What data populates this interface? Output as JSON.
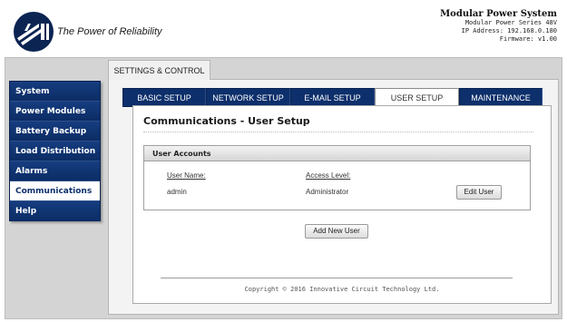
{
  "header": {
    "tagline": "The Power of Reliability",
    "system_title": "Modular Power System",
    "model": "Modular Power Series 48V",
    "ip_address": "IP Address: 192.168.0.180",
    "firmware": "Firmware: v1.00"
  },
  "sidebar": {
    "items": [
      {
        "label": "System"
      },
      {
        "label": "Power Modules"
      },
      {
        "label": "Battery Backup"
      },
      {
        "label": "Load Distribution"
      },
      {
        "label": "Alarms"
      },
      {
        "label": "Communications"
      },
      {
        "label": "Help"
      }
    ],
    "active": "Communications"
  },
  "settings_tab": {
    "label": "SETTINGS & CONTROL"
  },
  "tabs": [
    {
      "label": "BASIC SETUP"
    },
    {
      "label": "NETWORK SETUP"
    },
    {
      "label": "E-MAIL SETUP"
    },
    {
      "label": "USER SETUP"
    },
    {
      "label": "MAINTENANCE"
    }
  ],
  "active_tab": "USER SETUP",
  "content": {
    "title": "Communications - User Setup",
    "accounts": {
      "heading": "User Accounts",
      "col_user": "User Name:",
      "col_access": "Access Level:",
      "row": {
        "user": "admin",
        "access": "Administrator",
        "edit_label": "Edit User"
      }
    },
    "add_user_label": "Add New User",
    "copyright": "Copyright © 2016 Innovative Circuit Technology Ltd."
  },
  "colors": {
    "brand_navy": "#0d2f6b",
    "panel_grey": "#d4d4d4"
  }
}
